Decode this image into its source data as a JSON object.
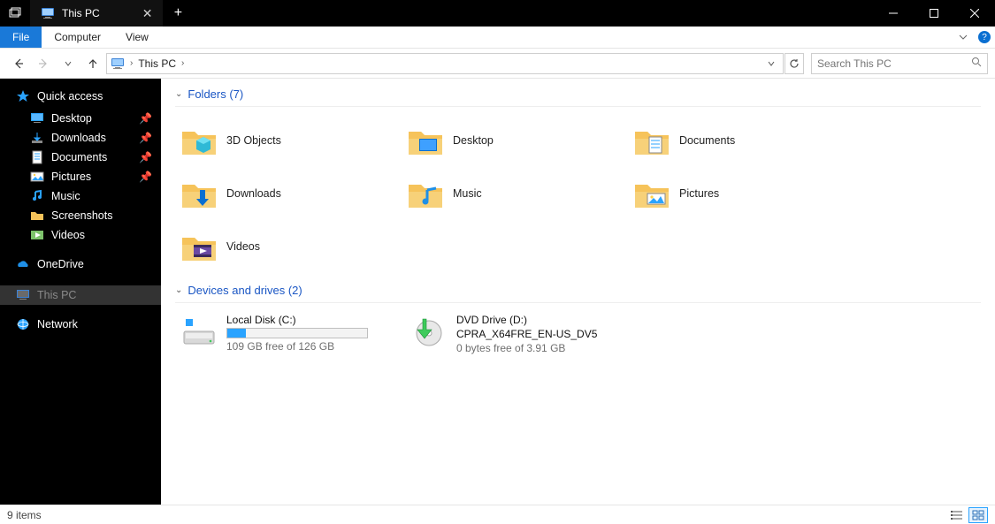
{
  "titlebar": {
    "tab_title": "This PC",
    "tab_icon": "thispc-icon"
  },
  "ribbon": {
    "file": "File",
    "tabs": [
      "Computer",
      "View"
    ]
  },
  "address": {
    "segments": [
      "This PC"
    ],
    "search_placeholder": "Search This PC"
  },
  "nav": {
    "quick_access": "Quick access",
    "pinned": [
      {
        "icon": "desktop-icon",
        "label": "Desktop"
      },
      {
        "icon": "downloads-icon",
        "label": "Downloads"
      },
      {
        "icon": "documents-icon",
        "label": "Documents"
      },
      {
        "icon": "pictures-icon",
        "label": "Pictures"
      }
    ],
    "recent": [
      {
        "icon": "music-icon",
        "label": "Music"
      },
      {
        "icon": "screenshots-icon",
        "label": "Screenshots"
      },
      {
        "icon": "videos-icon",
        "label": "Videos"
      }
    ],
    "onedrive": "OneDrive",
    "thispc": "This PC",
    "network": "Network"
  },
  "sections": {
    "folders_header": "Folders (7)",
    "folders": [
      {
        "icon": "objects3d-icon",
        "label": "3D Objects"
      },
      {
        "icon": "desktop-icon",
        "label": "Desktop"
      },
      {
        "icon": "documents-icon",
        "label": "Documents"
      },
      {
        "icon": "downloads-icon",
        "label": "Downloads"
      },
      {
        "icon": "music-icon",
        "label": "Music"
      },
      {
        "icon": "pictures-icon",
        "label": "Pictures"
      },
      {
        "icon": "videos-icon",
        "label": "Videos"
      }
    ],
    "drives_header": "Devices and drives (2)",
    "drives": [
      {
        "icon": "hdd-icon",
        "title": "Local Disk (C:)",
        "free_text": "109 GB free of 126 GB",
        "fill_percent": 13
      },
      {
        "icon": "dvd-icon",
        "title": "DVD Drive (D:)",
        "subtitle": "CPRA_X64FRE_EN-US_DV5",
        "free_text": "0 bytes free of 3.91 GB"
      }
    ]
  },
  "status": {
    "items": "9 items"
  }
}
